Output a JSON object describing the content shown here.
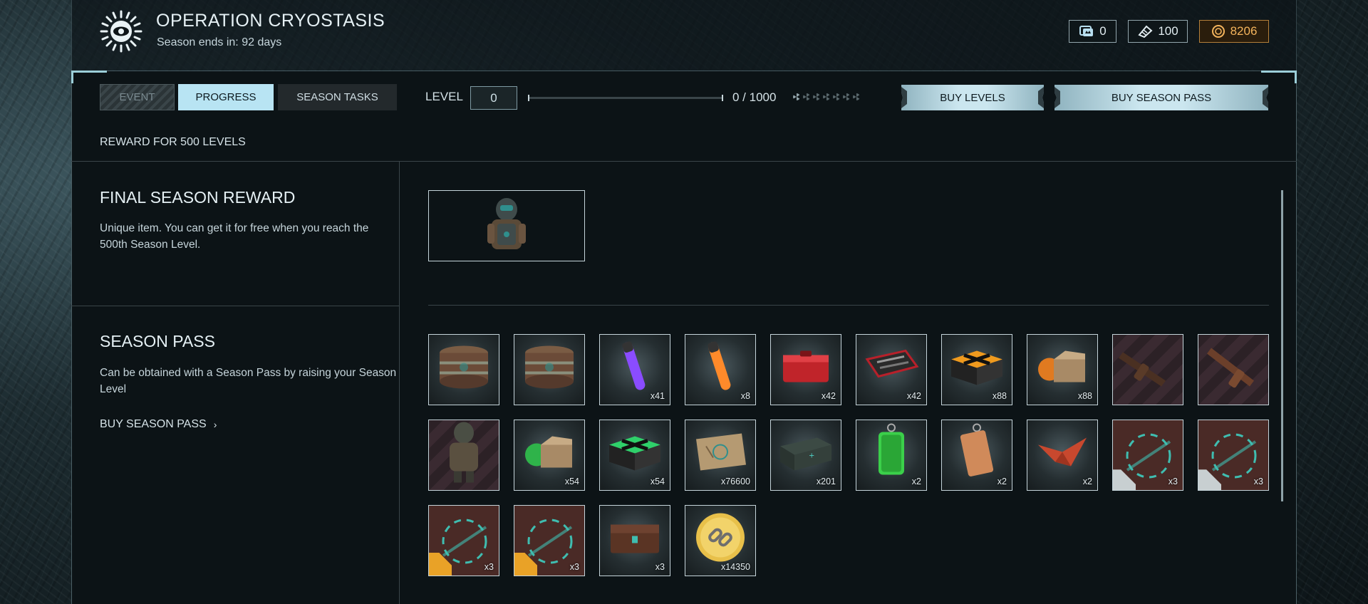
{
  "header": {
    "title": "OPERATION CRYOSTASIS",
    "season_ends": "Season ends in: 92 days",
    "currencies": [
      {
        "icon": "crowns-icon",
        "value": "0"
      },
      {
        "icon": "ticket-icon",
        "value": "100"
      },
      {
        "icon": "gold-coin-icon",
        "value": "8206",
        "color": "#f4b45c"
      }
    ]
  },
  "tabs": [
    {
      "label": "EVENT",
      "state": "disabled"
    },
    {
      "label": "PROGRESS",
      "state": "active"
    },
    {
      "label": "SEASON TASKS",
      "state": "normal"
    }
  ],
  "level": {
    "label": "LEVEL",
    "value": "0",
    "progress_text": "0 / 1000",
    "progress_fraction": 0
  },
  "buttons": {
    "buy_levels": "BUY LEVELS",
    "buy_season_pass": "BUY SEASON PASS"
  },
  "reward_header": "REWARD FOR 500 LEVELS",
  "final_reward": {
    "title": "FINAL SEASON  REWARD",
    "description": "Unique item. You can get it for free when you reach the 500th Season Level.",
    "item_icon": "armor-suit-icon"
  },
  "season_pass": {
    "title": "SEASON PASS",
    "description": "Can be obtained with a Season Pass by raising your Season Level",
    "link": "BUY SEASON PASS"
  },
  "rewards": [
    {
      "icon": "crate-round-icon",
      "qty": ""
    },
    {
      "icon": "crate-round-icon",
      "qty": ""
    },
    {
      "icon": "purple-glowstick-icon",
      "qty": "x41"
    },
    {
      "icon": "orange-glowstick-icon",
      "qty": "x8"
    },
    {
      "icon": "red-case-icon",
      "qty": "x42"
    },
    {
      "icon": "tool-kit-icon",
      "qty": "x42"
    },
    {
      "icon": "orange-x-box-icon",
      "qty": "x88"
    },
    {
      "icon": "orange-box-icon",
      "qty": "x88"
    },
    {
      "icon": "rifle-skin-icon",
      "qty": ""
    },
    {
      "icon": "shotgun-skin-icon",
      "qty": ""
    },
    {
      "icon": "armor-suit-icon",
      "qty": ""
    },
    {
      "icon": "green-box-icon",
      "qty": "x54"
    },
    {
      "icon": "green-x-box-icon",
      "qty": "x54"
    },
    {
      "icon": "map-icon",
      "qty": "x76600"
    },
    {
      "icon": "ammo-crate-icon",
      "qty": "x201"
    },
    {
      "icon": "green-tag-icon",
      "qty": "x2"
    },
    {
      "icon": "orange-tag-icon",
      "qty": "x2"
    },
    {
      "icon": "origami-bird-icon",
      "qty": "x2"
    },
    {
      "icon": "camo-armor-icon",
      "qty": "x3"
    },
    {
      "icon": "camo-armor-icon",
      "qty": "x3"
    },
    {
      "icon": "camo-weapon-icon",
      "qty": "x3"
    },
    {
      "icon": "camo-weapon-icon",
      "qty": "x3"
    },
    {
      "icon": "chest-icon",
      "qty": "x3"
    },
    {
      "icon": "gold-chain-coin-icon",
      "qty": "x14350"
    }
  ]
}
